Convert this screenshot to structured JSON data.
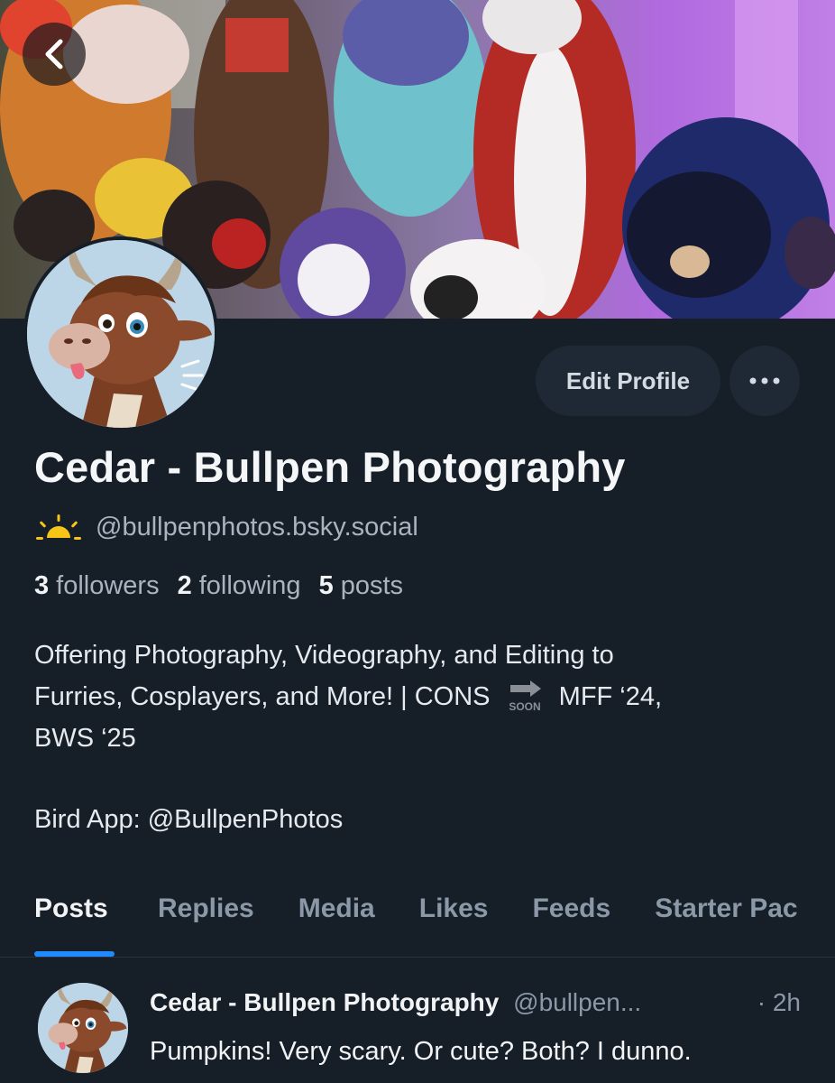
{
  "banner": {
    "image_desc": "banner-photo"
  },
  "profile": {
    "display_name": "Cedar - Bullpen Photography",
    "handle": "@bullpenphotos.bsky.social",
    "handle_icon": "sun-icon",
    "edit_profile_label": "Edit Profile",
    "more_label": "•••",
    "stats": {
      "followers_count": "3",
      "followers_label": "followers",
      "following_count": "2",
      "following_label": "following",
      "posts_count": "5",
      "posts_label": "posts"
    },
    "bio": {
      "line1": "Offering Photography, Videography, and Editing to",
      "line2_before": "Furries, Cosplayers, and More! | CONS",
      "line2_after": "MFF ‘24,",
      "line3": "BWS ‘25",
      "line4": "Bird App: @BullpenPhotos",
      "soon_icon_label": "SOON"
    }
  },
  "tabs": [
    {
      "label": "Posts",
      "active": true
    },
    {
      "label": "Replies",
      "active": false
    },
    {
      "label": "Media",
      "active": false
    },
    {
      "label": "Likes",
      "active": false
    },
    {
      "label": "Feeds",
      "active": false
    },
    {
      "label": "Starter Pac",
      "active": false
    }
  ],
  "post": {
    "author": "Cedar - Bullpen Photography",
    "handle": "@bullpen...",
    "time": "· 2h",
    "text": "Pumpkins! Very scary. Or cute? Both? I dunno."
  },
  "colors": {
    "background": "#161e27",
    "accent": "#208bfe",
    "muted_text": "#8a98a7",
    "button_bg": "#1f2935"
  }
}
